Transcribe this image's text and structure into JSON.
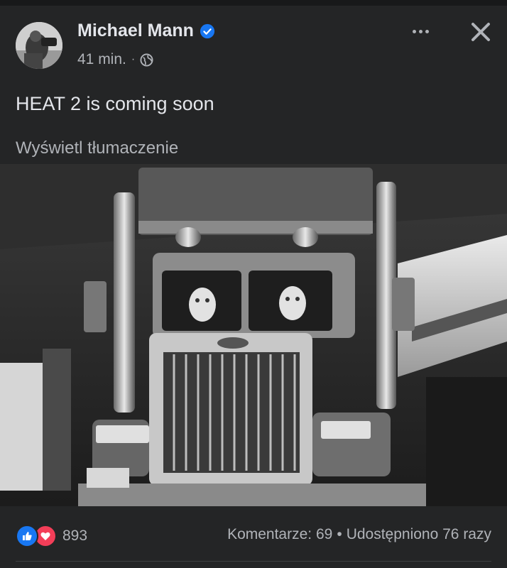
{
  "post": {
    "author": "Michael Mann",
    "verified": true,
    "time": "41 min.",
    "text": "HEAT 2 is coming soon",
    "translate_link": "Wyświetl tłumaczenie",
    "image_alt": "Black-and-white photo of a truck with two drivers in hockey masks"
  },
  "engagement": {
    "reaction_count": "893",
    "comments": "Komentarze: 69",
    "separator": "•",
    "shares": "Udostępniono 76 razy"
  },
  "colors": {
    "background": "#242526",
    "primary_text": "#e4e6eb",
    "secondary_text": "#b0b3b8",
    "verified_blue": "#1877f2",
    "love_red": "#f33e58"
  },
  "icons": [
    "verified-badge-icon",
    "globe-icon",
    "more-options-icon",
    "close-icon",
    "like-reaction-icon",
    "love-reaction-icon"
  ]
}
